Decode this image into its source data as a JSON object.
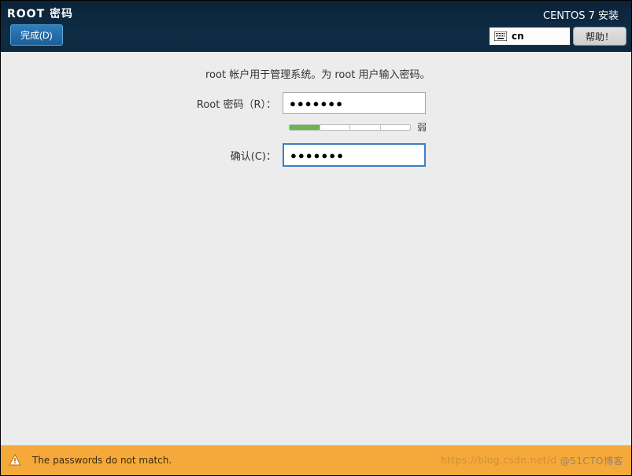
{
  "header": {
    "page_title": "ROOT 密码",
    "done_label": "完成(D)",
    "installer_name": "CENTOS 7 安装",
    "lang_code": "cn",
    "help_label": "帮助！"
  },
  "form": {
    "instruction": "root 帐户用于管理系统。为 root 用户输入密码。",
    "root_pw_label": "Root 密码（R）：",
    "root_pw_value": "●●●●●●●",
    "confirm_label": "确认(C)：",
    "confirm_value": "●●●●●●●",
    "strength_text": "弱",
    "strength_segments_total": 4,
    "strength_segments_filled": 1
  },
  "warning": {
    "message": "The passwords do not match."
  },
  "watermark": {
    "line1": "https://blog.csdn.net/d",
    "line2": "@51CTO博客"
  }
}
